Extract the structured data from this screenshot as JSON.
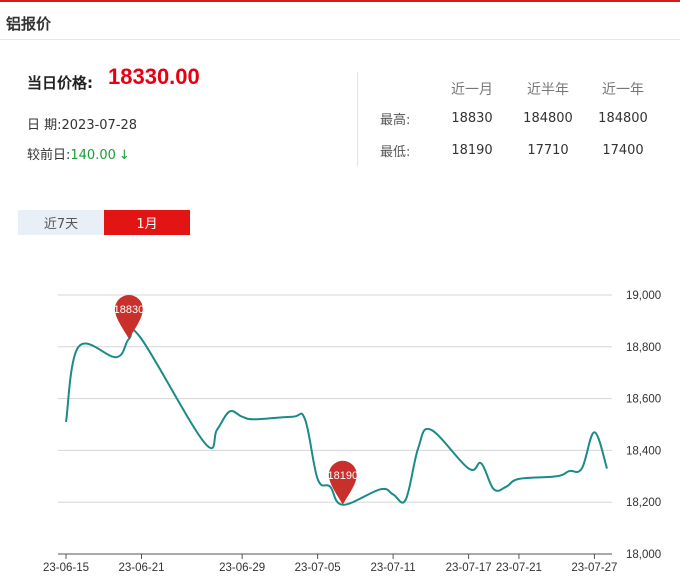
{
  "header": {
    "title": "铝报价"
  },
  "today": {
    "label": "当日价格:",
    "price": "18330.00"
  },
  "date": {
    "label": "日 期:",
    "value": "2023-07-28"
  },
  "compare": {
    "label": "较前日:",
    "value": "140.00",
    "arrow": "↓",
    "color": "#1a9d3a"
  },
  "stats": {
    "columns": [
      "近一月",
      "近半年",
      "近一年"
    ],
    "rows": [
      {
        "label": "最高:",
        "values": [
          "18830",
          "184800",
          "184800"
        ]
      },
      {
        "label": "最低:",
        "values": [
          "18190",
          "17710",
          "17400"
        ]
      }
    ]
  },
  "tabs": [
    {
      "label": "近7天",
      "active": false
    },
    {
      "label": "1月",
      "active": true
    }
  ],
  "colors": {
    "accent": "#e31414",
    "line": "#1a8a8a",
    "marker": "#c9302c"
  },
  "chart_data": {
    "type": "line",
    "title": "",
    "xlabel": "",
    "ylabel": "",
    "ylim": [
      18000,
      19000
    ],
    "yticks": [
      "19,000",
      "18,800",
      "18,600",
      "18,400",
      "18,200",
      "18,000"
    ],
    "x_tick_labels": [
      "23-06-15",
      "23-06-21",
      "23-06-29",
      "23-07-05",
      "23-07-11",
      "23-07-17",
      "23-07-21",
      "23-07-27"
    ],
    "grid": true,
    "y_axis_position": "right",
    "series": [
      {
        "x": [
          "23-06-15",
          "23-06-16",
          "23-06-19",
          "23-06-20",
          "23-06-21",
          "23-06-26",
          "23-06-27",
          "23-06-28",
          "23-06-29",
          "23-06-30",
          "23-07-03",
          "23-07-04",
          "23-07-05",
          "23-07-06",
          "23-07-07",
          "23-07-10",
          "23-07-11",
          "23-07-12",
          "23-07-13",
          "23-07-14",
          "23-07-17",
          "23-07-18",
          "23-07-19",
          "23-07-20",
          "23-07-21",
          "23-07-24",
          "23-07-25",
          "23-07-26",
          "23-07-27",
          "23-07-28"
        ],
        "values": [
          18510,
          18800,
          18760,
          18830,
          18830,
          18430,
          18480,
          18550,
          18530,
          18520,
          18530,
          18520,
          18290,
          18260,
          18190,
          18250,
          18230,
          18210,
          18410,
          18480,
          18330,
          18350,
          18250,
          18260,
          18290,
          18300,
          18320,
          18330,
          18470,
          18330
        ]
      }
    ],
    "markers": [
      {
        "label": "18830",
        "x": "23-06-20",
        "value": 18830
      },
      {
        "label": "18190",
        "x": "23-07-07",
        "value": 18190
      }
    ]
  }
}
